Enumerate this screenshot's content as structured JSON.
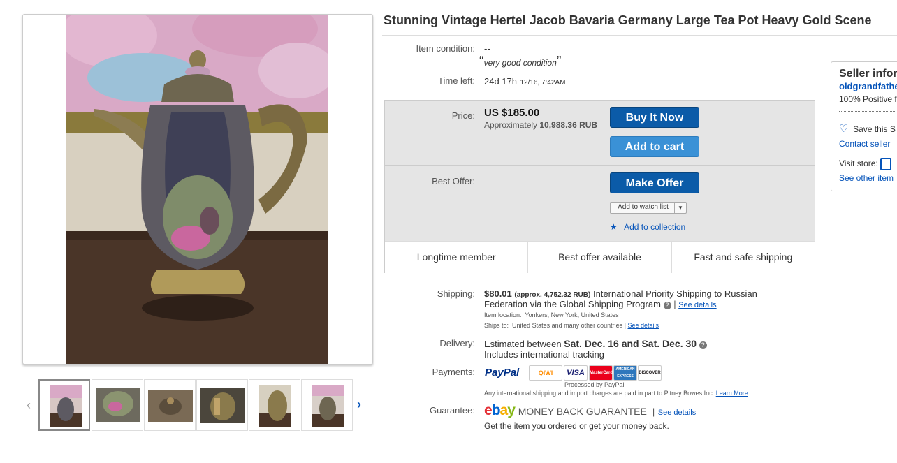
{
  "listing": {
    "title": "Stunning Vintage Hertel Jacob Bavaria Germany Large Tea Pot Heavy Gold Scene"
  },
  "gallery": {
    "thumb_count": 6
  },
  "details": {
    "condition_label": "Item condition:",
    "condition_value": "--",
    "condition_quote": "very good condition",
    "time_left_label": "Time left:",
    "time_left_value": "24d 17h",
    "time_left_end": "12/16, 7:42AM"
  },
  "buybox": {
    "price_label": "Price:",
    "price_value": "US $185.00",
    "approx_prefix": "Approximately",
    "approx_value": "10,988.36 RUB",
    "buy_now": "Buy It Now",
    "add_to_cart": "Add to cart",
    "best_offer_label": "Best Offer:",
    "make_offer": "Make Offer",
    "watch_list": "Add to watch list",
    "add_collection": "Add to collection",
    "features": [
      "Longtime member",
      "Best offer available",
      "Fast and safe shipping"
    ]
  },
  "shipping": {
    "label": "Shipping:",
    "cost": "$80.01",
    "approx": "(approx. 4,752.32 RUB)",
    "service_line1": "International Priority Shipping to Russian",
    "service_line2": "Federation  via the Global Shipping Program",
    "see_details": "See details",
    "location_label": "Item location:",
    "location_value": "Yonkers, New York, United States",
    "ships_to_label": "Ships to:",
    "ships_to_value": "United States and many other countries",
    "ships_to_link": "See details"
  },
  "delivery": {
    "label": "Delivery:",
    "prefix": "Estimated between",
    "dates": "Sat. Dec. 16 and Sat. Dec. 30",
    "tracking": "Includes international tracking"
  },
  "payments": {
    "label": "Payments:",
    "paypal": "PayPal",
    "qiwi": "QIWI",
    "visa": "VISA",
    "mastercard": "MasterCard",
    "amex": "AMERICAN EXPRESS",
    "discover": "DISCOVER",
    "processed": "Processed by PayPal",
    "note": "Any international shipping and import charges are paid in part to Pitney Bowes Inc.",
    "learn_more": "Learn More"
  },
  "guarantee": {
    "label": "Guarantee:",
    "logo": "ebay",
    "text": "MONEY BACK GUARANTEE",
    "see_details": "See details",
    "sub": "Get the item you ordered or get your money back."
  },
  "seller": {
    "heading": "Seller infor",
    "name": "oldgrandfathe",
    "feedback": "100% Positive f",
    "save": "Save this S",
    "contact": "Contact seller",
    "visit_store": "Visit store:",
    "see_other": "See other item"
  },
  "colors": {
    "link": "#0654ba",
    "buy_button": "#0b5ba8",
    "cart_button": "#3a91d6",
    "ebay_red": "#e53238",
    "ebay_blue": "#0064d2",
    "ebay_yellow": "#f5af02",
    "ebay_green": "#86b817"
  }
}
